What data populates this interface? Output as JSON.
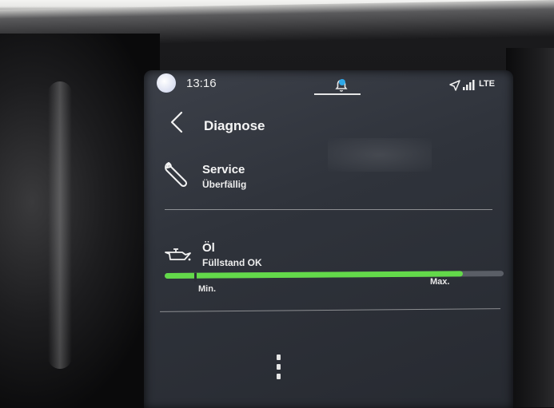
{
  "status_bar": {
    "time": "13:16",
    "network": "LTE",
    "icons": [
      "profile-avatar",
      "notification-bell-icon",
      "navigation-arrow-icon",
      "signal-strength-icon"
    ]
  },
  "header": {
    "back_icon": "chevron-left-icon",
    "title": "Diagnose"
  },
  "service": {
    "icon": "wrench-icon",
    "title": "Service",
    "status": "Überfällig"
  },
  "oil": {
    "icon": "oil-can-icon",
    "title": "Öl",
    "status": "Füllstand OK",
    "gauge": {
      "min_label": "Min.",
      "max_label": "Max.",
      "level_fraction": 0.88
    }
  },
  "colors": {
    "accent_green": "#63d94a",
    "notification_blue": "#2ea8e8",
    "screen_bg": "#2f333b"
  }
}
